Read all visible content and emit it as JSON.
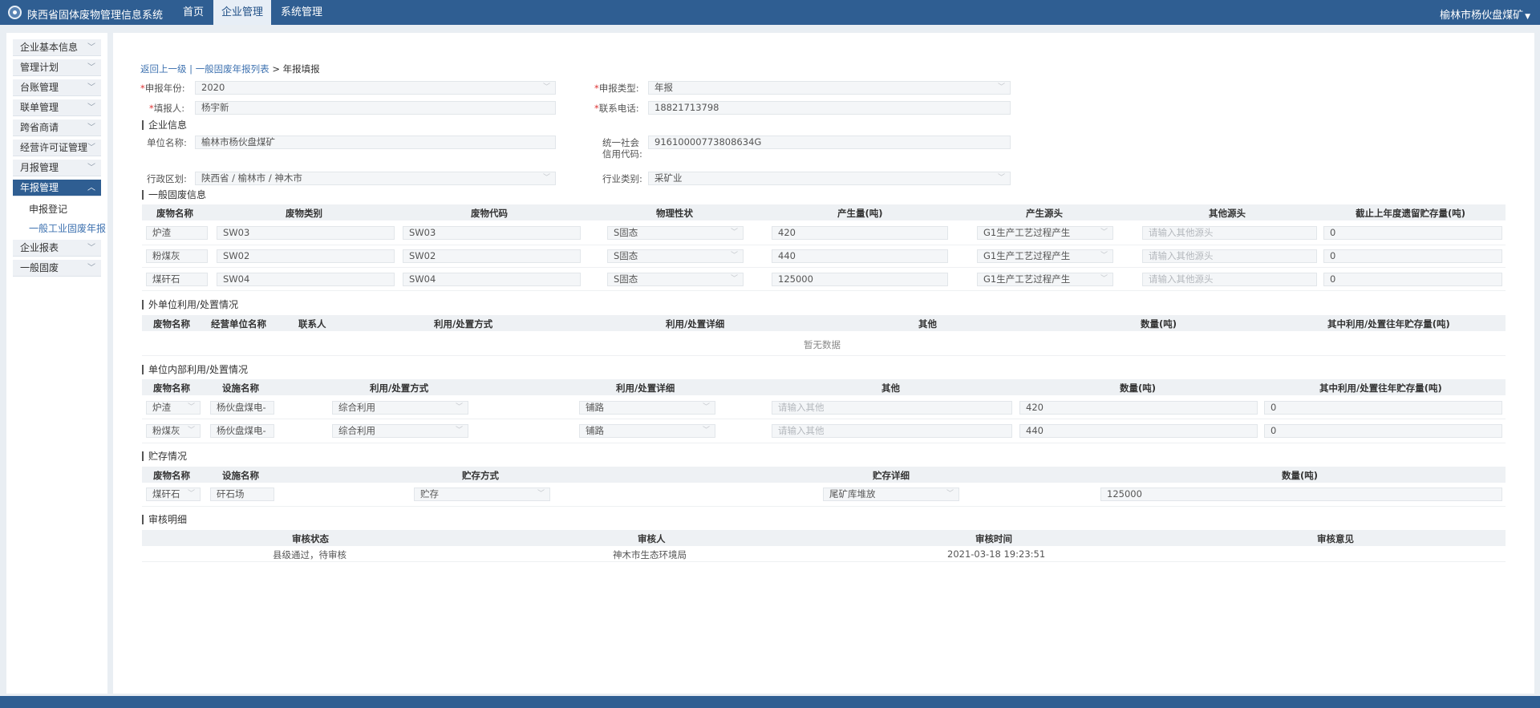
{
  "topbar": {
    "title": "陕西省固体废物管理信息系统",
    "nav": [
      "首页",
      "企业管理",
      "系统管理"
    ],
    "user": "榆林市杨伙盘煤矿"
  },
  "sidebar": {
    "items": [
      "企业基本信息",
      "管理计划",
      "台账管理",
      "联单管理",
      "跨省商请",
      "经营许可证管理",
      "月报管理",
      "年报管理",
      "企业报表",
      "一般固废"
    ],
    "sub_items": [
      "申报登记",
      "一般工业固废年报"
    ]
  },
  "breadcrumb": {
    "back": "返回上一级",
    "sep1": " | ",
    "list": "一般固废年报列表",
    "sep2": " > ",
    "current": "年报填报"
  },
  "form": {
    "year_label": "申报年份:",
    "year": "2020",
    "type_label": "申报类型:",
    "type": "年报",
    "reporter_label": "填报人:",
    "reporter": "杨宇新",
    "phone_label": "联系电话:",
    "phone": "18821713798",
    "required": "*"
  },
  "company": {
    "section": "企业信息",
    "name_label": "单位名称:",
    "name": "榆林市杨伙盘煤矿",
    "credit_label_1": "统一社会",
    "credit_label_2": "信用代码:",
    "credit": "91610000773808634G",
    "region_label": "行政区划:",
    "region": "陕西省 / 榆林市 / 神木市",
    "industry_label": "行业类别:",
    "industry": "采矿业"
  },
  "waste": {
    "section": "一般固废信息",
    "headers": [
      "废物名称",
      "废物类别",
      "废物代码",
      "物理性状",
      "产生量(吨)",
      "产生源头",
      "其他源头",
      "截止上年度遗留贮存量(吨)"
    ],
    "other_placeholder": "请输入其他源头",
    "rows": [
      [
        "炉渣",
        "SW03",
        "SW03",
        "S固态",
        "420",
        "G1生产工艺过程产生",
        "0"
      ],
      [
        "粉煤灰",
        "SW02",
        "SW02",
        "S固态",
        "440",
        "G1生产工艺过程产生",
        "0"
      ],
      [
        "煤矸石",
        "SW04",
        "SW04",
        "S固态",
        "125000",
        "G1生产工艺过程产生",
        "0"
      ]
    ]
  },
  "external": {
    "section": "外单位利用/处置情况",
    "headers": [
      "废物名称",
      "经营单位名称",
      "联系人",
      "利用/处置方式",
      "利用/处置详细",
      "其他",
      "数量(吨)",
      "其中利用/处置往年贮存量(吨)"
    ],
    "empty": "暂无数据"
  },
  "internal": {
    "section": "单位内部利用/处置情况",
    "headers": [
      "废物名称",
      "设施名称",
      "利用/处置方式",
      "利用/处置详细",
      "其他",
      "数量(吨)",
      "其中利用/处置往年贮存量(吨)"
    ],
    "other_placeholder": "请输入其他",
    "rows": [
      [
        "炉渣",
        "杨伙盘煤电-",
        "综合利用",
        "铺路",
        "420",
        "0"
      ],
      [
        "粉煤灰",
        "杨伙盘煤电-",
        "综合利用",
        "铺路",
        "440",
        "0"
      ]
    ]
  },
  "storage": {
    "section": "贮存情况",
    "headers": [
      "废物名称",
      "设施名称",
      "贮存方式",
      "贮存详细",
      "数量(吨)"
    ],
    "rows": [
      [
        "煤矸石",
        "矸石场",
        "贮存",
        "尾矿库堆放",
        "125000"
      ]
    ]
  },
  "review": {
    "section": "审核明细",
    "headers": [
      "审核状态",
      "审核人",
      "审核时间",
      "审核意见"
    ],
    "rows": [
      [
        "县级通过，待审核",
        "神木市生态环境局",
        "2021-03-18 19:23:51",
        ""
      ]
    ]
  }
}
